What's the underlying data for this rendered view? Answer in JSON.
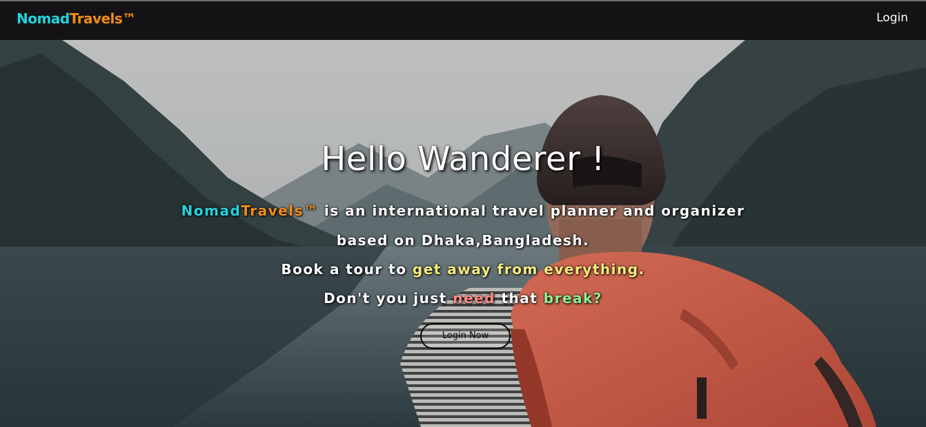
{
  "navbar": {
    "brand_part1": "Nomad",
    "brand_part2": "Travels™",
    "login_label": "Login"
  },
  "hero": {
    "title": "Hello Wanderer !",
    "line1": {
      "brand_part1": "Nomad",
      "brand_part2": "Travels™",
      "text": " is an international travel planner and organizer"
    },
    "line2": "based on Dhaka,Bangladesh.",
    "line3": {
      "prefix": "Book a tour to ",
      "highlight": "get away from everything."
    },
    "line4": {
      "prefix": "Don't you just ",
      "need": "need",
      "middle": " that ",
      "break": "break?"
    },
    "button_label": "Login Now"
  },
  "colors": {
    "brand_cyan": "#22d4dc",
    "brand_orange": "#f08c18",
    "highlight_yellow": "#f2ec7c",
    "highlight_red": "#ff8a80",
    "highlight_green": "#8ef08e",
    "navbar_bg": "#141214"
  }
}
